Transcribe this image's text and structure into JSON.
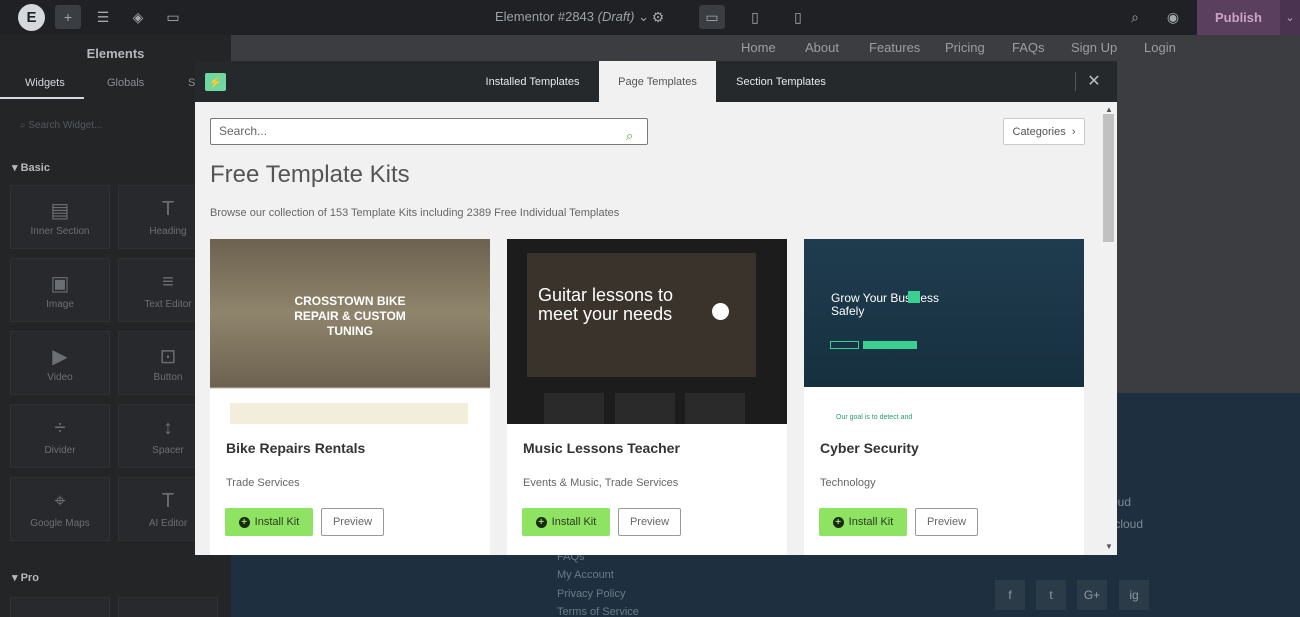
{
  "topbar": {
    "logo": "E",
    "title": "Elementor #2843",
    "title_state": "(Draft)",
    "publish": "Publish"
  },
  "sidebar": {
    "title": "Elements",
    "tabs": [
      "Widgets",
      "Globals",
      "S"
    ],
    "search_placeholder": "Search Widget...",
    "basic_label": "Basic",
    "pro_label": "Pro",
    "widgets": [
      {
        "label": "Inner Section",
        "icon": "columns-icon"
      },
      {
        "label": "Heading",
        "icon": "heading-icon"
      },
      {
        "label": "Image",
        "icon": "image-icon"
      },
      {
        "label": "Text Editor",
        "icon": "text-editor-icon"
      },
      {
        "label": "Video",
        "icon": "video-icon"
      },
      {
        "label": "Button",
        "icon": "button-icon"
      },
      {
        "label": "Divider",
        "icon": "divider-icon"
      },
      {
        "label": "Spacer",
        "icon": "spacer-icon"
      },
      {
        "label": "Google Maps",
        "icon": "map-icon"
      },
      {
        "label": "AI Editor",
        "icon": "ai-editor-icon"
      }
    ]
  },
  "canvas": {
    "nav": [
      "Home",
      "About",
      "Features",
      "Pricing",
      "FAQs",
      "Sign Up",
      "Login"
    ],
    "footer_links": [
      "FAQs",
      "My Account",
      "Privacy Policy",
      "Terms of Service"
    ],
    "footer_right": [
      "oud",
      ".cloud"
    ],
    "social": [
      "f",
      "t",
      "G+",
      "ig"
    ]
  },
  "modal": {
    "tabs": [
      "Installed Templates",
      "Page Templates",
      "Section Templates"
    ],
    "active_tab": "Page Templates",
    "search_placeholder": "Search...",
    "categories": "Categories",
    "heading": "Free Template Kits",
    "subheading": "Browse our collection of 153 Template Kits including 2389 Free Individual Templates",
    "install_label": "Install Kit",
    "preview_label": "Preview",
    "kits": [
      {
        "title": "Bike Repairs Rentals",
        "category": "Trade Services",
        "thumb_text": "CROSSTOWN BIKE REPAIR & CUSTOM TUNING"
      },
      {
        "title": "Music Lessons Teacher",
        "category": "Events & Music, Trade Services",
        "thumb_text": "Guitar lessons to meet your needs"
      },
      {
        "title": "Cyber Security",
        "category": "Technology",
        "thumb_text": "Grow Your Business Safely",
        "thumb_sub": "Our goal is to detect and"
      }
    ]
  },
  "colors": {
    "accent_green": "#8fe363",
    "publish_bg": "#5b3f5f",
    "modal_header": "#26292c"
  }
}
